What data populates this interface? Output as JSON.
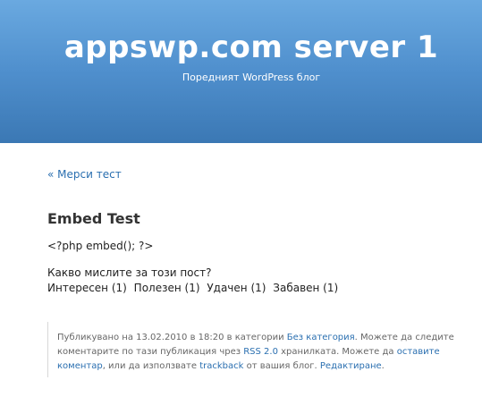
{
  "header": {
    "blog_title": "appswp.com server 1",
    "tagline": "Поредният WordPress блог"
  },
  "navigation": {
    "prev_arrow": "«",
    "prev_link": "Мерси тест"
  },
  "post": {
    "title": "Embed Test",
    "body": "<?php embed(); ?>"
  },
  "poll": {
    "question": "Какво мислите за този пост?",
    "options": [
      "Интересен (1)",
      "Полезен (1)",
      "Удачен (1)",
      "Забавен (1)"
    ]
  },
  "meta": {
    "text1": "Публикувано на 13.02.2010 в 18:20 в категории ",
    "category_link": "Без категория",
    "text2": ". Можете да следите коментарите по тази публикация чрез ",
    "rss_link": "RSS 2.0",
    "text3": " хранилката. Можете да ",
    "leave_comment_link": "оставите коментар",
    "text4": ", или да използвате ",
    "trackback_link": "trackback",
    "text5": " от вашия блог. ",
    "edit_link": "Редактиране",
    "text6": "."
  },
  "colors": {
    "link": "#2a6fb0",
    "header_top": "#6aa9e0",
    "header_bottom": "#3b78b4"
  }
}
